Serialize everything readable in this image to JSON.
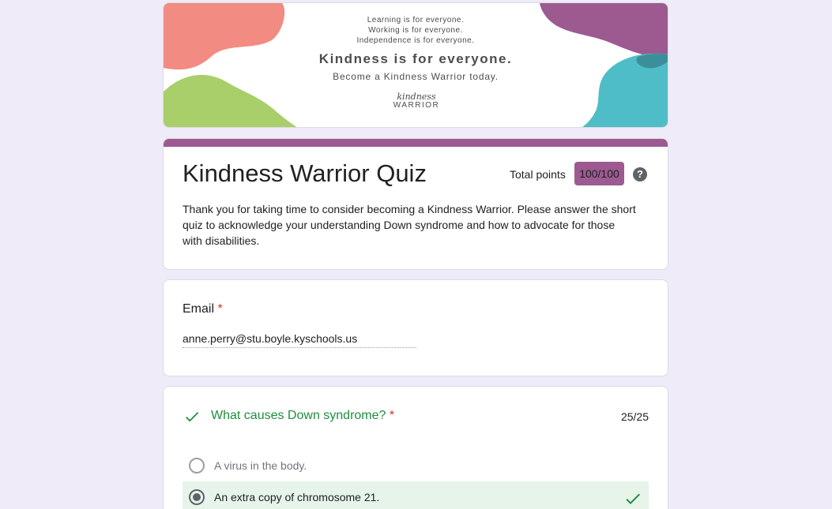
{
  "banner": {
    "line1": "Learning is for everyone.",
    "line2": "Working is for everyone.",
    "line3": "Independence is for everyone.",
    "headline": "Kindness is for everyone.",
    "subline": "Become a Kindness Warrior today.",
    "logo_top": "kindness",
    "logo_bottom": "WARRIOR",
    "logo_small": "",
    "colors": {
      "coral": "#f28b82",
      "green": "#a8cf6a",
      "purple": "#9c5a91",
      "teal": "#4fbdc7"
    }
  },
  "form": {
    "title": "Kindness Warrior Quiz",
    "points_label": "Total points",
    "points_value": "100/100",
    "help_icon": "help-circle-icon",
    "description": "Thank you for taking time to consider becoming a Kindness Warrior. Please answer the short quiz to acknowledge your understanding Down syndrome and how to advocate for those with disabilities.",
    "accent_color": "#9c5a91"
  },
  "email": {
    "label": "Email",
    "required_mark": "*",
    "value": "anne.perry@stu.boyle.kyschools.us"
  },
  "question": {
    "title": "What causes Down syndrome?",
    "required_mark": "*",
    "score": "25/25",
    "status_icon": "check-icon",
    "options": [
      {
        "label": "A virus in the body.",
        "selected": false
      },
      {
        "label": "An extra copy of chromosome 21.",
        "selected": true,
        "correct": true
      }
    ]
  }
}
